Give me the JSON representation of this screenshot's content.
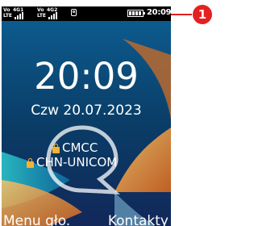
{
  "status_bar": {
    "sim1": {
      "volte": "Vo\nLTE",
      "network": "4G1"
    },
    "sim2": {
      "volte": "Vo\nLTE",
      "network": "4G2"
    },
    "battery_level": 1.0,
    "time": "20:09"
  },
  "home": {
    "clock": "20:09",
    "date": "Czw 20.07.2023",
    "operators": [
      "CMCC",
      "CHN-UNICOM"
    ]
  },
  "softkeys": {
    "left": "Menu gło.",
    "right": "Kontakty"
  },
  "callout": {
    "number": "1",
    "color": "#e42120"
  },
  "colors": {
    "accent": "#e42120",
    "lock": "#f2b233"
  },
  "icons": [
    "signal-icon",
    "message-icon",
    "battery-icon",
    "lock-icon"
  ]
}
